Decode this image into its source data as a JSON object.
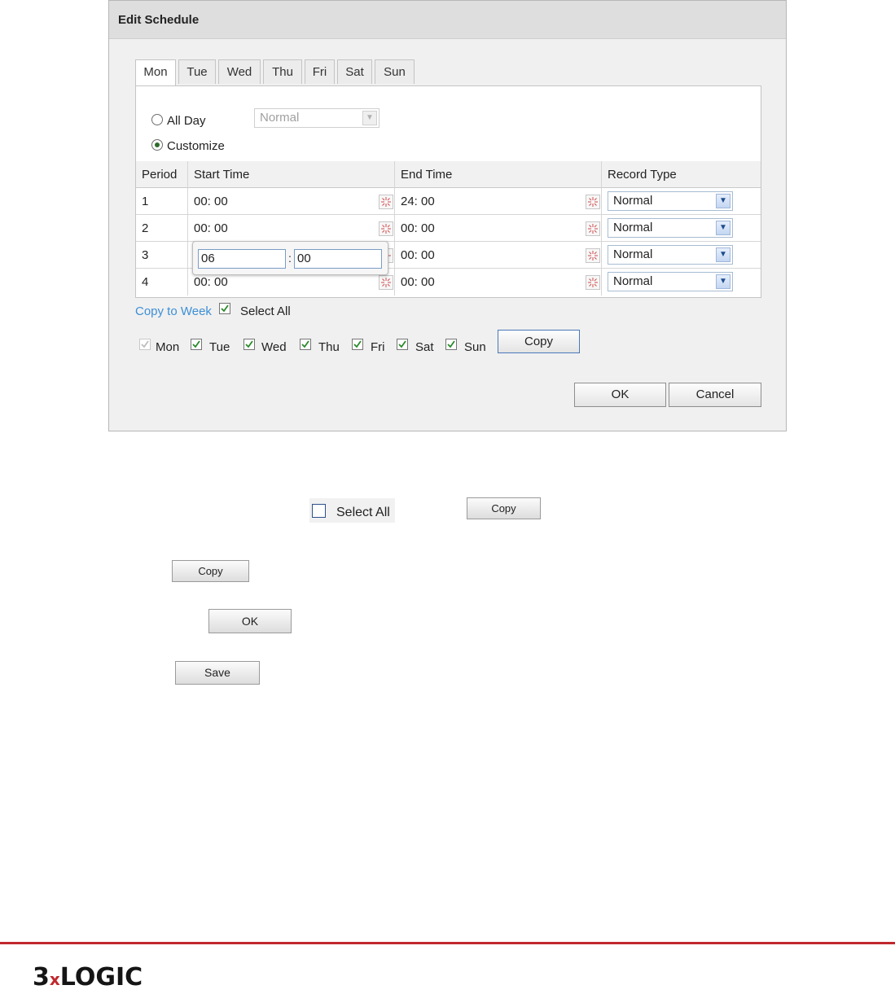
{
  "dialog": {
    "title": "Edit Schedule",
    "tabs": [
      {
        "label": "Mon",
        "active": true
      },
      {
        "label": "Tue"
      },
      {
        "label": "Wed"
      },
      {
        "label": "Thu"
      },
      {
        "label": "Fri"
      },
      {
        "label": "Sat"
      },
      {
        "label": "Sun"
      }
    ],
    "mode": {
      "all_day_label": "All Day",
      "all_day_type": "Normal",
      "customize_label": "Customize",
      "selected": "Customize"
    },
    "table": {
      "headers": [
        "Period",
        "Start Time",
        "End Time",
        "Record Type"
      ],
      "rows": [
        {
          "period": "1",
          "start": "00: 00",
          "end": "24: 00",
          "type": "Normal"
        },
        {
          "period": "2",
          "start": "00: 00",
          "end": "00: 00",
          "type": "Normal"
        },
        {
          "period": "3",
          "start": "",
          "end": "00: 00",
          "type": "Normal"
        },
        {
          "period": "4",
          "start": "00: 00",
          "end": "00: 00",
          "type": "Normal"
        }
      ]
    },
    "time_picker": {
      "hour": "06",
      "separator": ":",
      "minute": "00"
    },
    "copy_to_week_label": "Copy to Week",
    "select_all_label": "Select All",
    "days": [
      {
        "label": "Mon",
        "checked": true,
        "disabled": true
      },
      {
        "label": "Tue",
        "checked": true
      },
      {
        "label": "Wed",
        "checked": true
      },
      {
        "label": "Thu",
        "checked": true
      },
      {
        "label": "Fri",
        "checked": true
      },
      {
        "label": "Sat",
        "checked": true
      },
      {
        "label": "Sun",
        "checked": true
      }
    ],
    "copy_label": "Copy",
    "ok_label": "OK",
    "cancel_label": "Cancel"
  },
  "steps": {
    "select_all_label": "Select All",
    "copy_label": "Copy",
    "copy2_label": "Copy",
    "ok_label": "OK",
    "save_label": "Save"
  },
  "footer": {
    "logo_text_a": "3",
    "logo_text_x": "x",
    "logo_text_b": "LOGIC",
    "accent_color": "#c0282d"
  }
}
